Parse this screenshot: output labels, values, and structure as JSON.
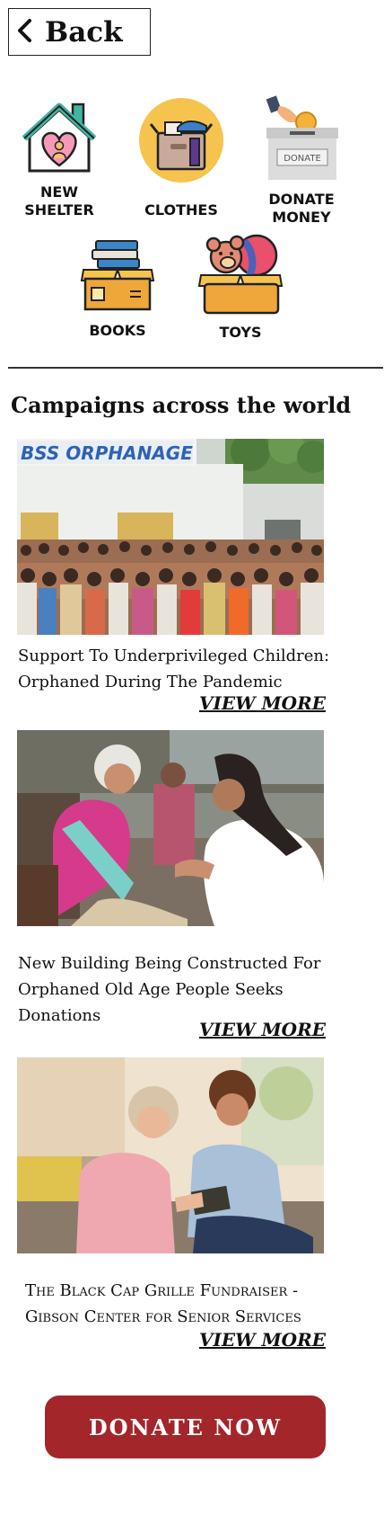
{
  "header": {
    "back_label": "Back"
  },
  "categories": [
    {
      "id": "new-shelter",
      "label": "NEW\nSHELTER",
      "icon": "house-heart-icon"
    },
    {
      "id": "clothes",
      "label": "CLOTHES",
      "icon": "clothes-box-icon"
    },
    {
      "id": "donate-money",
      "label": "DONATE\nMONEY",
      "icon": "donation-box-icon",
      "icon_text": "DONATE"
    },
    {
      "id": "books",
      "label": "BOOKS",
      "icon": "books-box-icon"
    },
    {
      "id": "toys",
      "label": "TOYS",
      "icon": "toys-box-icon"
    }
  ],
  "section_title": "Campaigns across the world",
  "campaigns": [
    {
      "title_line1": "Support To Underprivileged Children:",
      "title_line2": "Orphaned During The Pandemic",
      "image_sign": "BSS ORPHANAGE",
      "view_more": "VIEW MORE"
    },
    {
      "title_line1": "New Building Being Constructed For",
      "title_line2": "Orphaned Old Age People Seeks Donations",
      "view_more": "VIEW MORE"
    },
    {
      "title_line1": "The Black Cap Grille Fundraiser -",
      "title_line2": "Gibson Center for Senior Services",
      "view_more": "VIEW MORE"
    }
  ],
  "donate_button": "DONATE NOW",
  "colors": {
    "donate_button": "#a3262a",
    "text": "#111111",
    "divider": "#333333"
  }
}
